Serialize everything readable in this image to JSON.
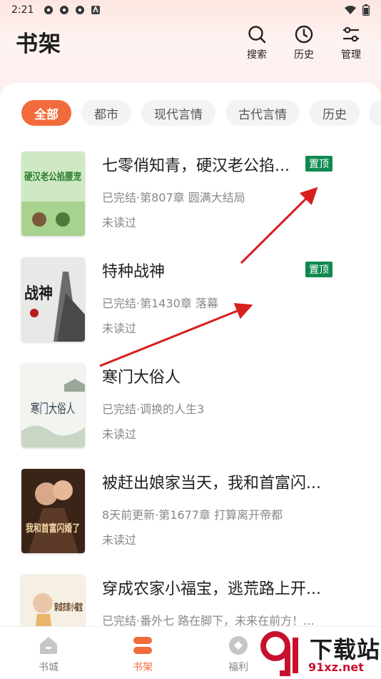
{
  "status_bar": {
    "time": "2:21"
  },
  "header": {
    "title": "书架",
    "actions": [
      {
        "label": "搜索",
        "icon": "search-icon"
      },
      {
        "label": "历史",
        "icon": "clock-icon"
      },
      {
        "label": "管理",
        "icon": "sliders-icon"
      }
    ]
  },
  "tabs": [
    {
      "label": "全部",
      "active": true
    },
    {
      "label": "都市"
    },
    {
      "label": "现代言情"
    },
    {
      "label": "古代言情"
    },
    {
      "label": "历史"
    }
  ],
  "books": [
    {
      "title": "七零俏知青，硬汉老公掐...",
      "pinned": true,
      "pin_label": "置顶",
      "progress": "已完结·第807章 圆满大结局",
      "read_status": "未读过",
      "cover_text": "硬汉老公掐腰宠"
    },
    {
      "title": "特种战神",
      "pinned": true,
      "pin_label": "置顶",
      "progress": "已完结·第1430章 落幕",
      "read_status": "未读过",
      "cover_text": "战神"
    },
    {
      "title": "寒门大俗人",
      "pinned": false,
      "progress": "已完结·调换的人生3",
      "read_status": "未读过",
      "cover_text": "寒门大俗人"
    },
    {
      "title": "被赶出娘家当天，我和首富闪...",
      "pinned": false,
      "progress": "8天前更新·第1677章 打算离开帝都",
      "read_status": "未读过",
      "cover_text": "我和首富闪婚了"
    },
    {
      "title": "穿成农家小福宝，逃荒路上开...",
      "pinned": false,
      "progress": "已完结·番外七 路在脚下，未来在前方！...",
      "read_status": "",
      "cover_text": "穿成农家小福宝"
    }
  ],
  "bottom_nav": [
    {
      "label": "书城",
      "icon": "store-icon",
      "active": false
    },
    {
      "label": "书架",
      "icon": "bookshelf-icon",
      "active": true
    },
    {
      "label": "福利",
      "icon": "gift-icon",
      "active": false
    }
  ],
  "watermark": {
    "text": "下载站",
    "url": "91xz.net"
  },
  "colors": {
    "accent": "#f26b3c",
    "pin_badge": "#0f8a4f",
    "annotation_arrow": "#d81e1e"
  }
}
